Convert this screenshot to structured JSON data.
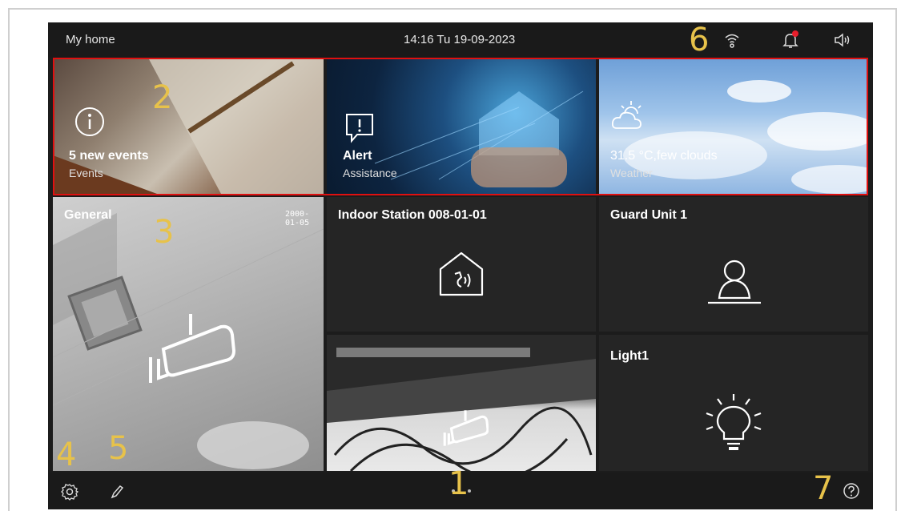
{
  "header": {
    "title": "My home",
    "clock": "14:16  Tu 19-09-2023"
  },
  "tiles": {
    "events": {
      "headline": "5 new events",
      "sub": "Events"
    },
    "alert": {
      "headline": "Alert",
      "sub": "Assistance"
    },
    "weather": {
      "headline": "31.5 °C,few clouds",
      "sub": "Weather"
    },
    "general": {
      "label": "General",
      "timestamp": "2000-01-05"
    },
    "indoor": {
      "label": "Indoor Station 008-01-01"
    },
    "guard": {
      "label": "Guard Unit 1"
    },
    "light": {
      "label": "Light1"
    }
  },
  "callouts": {
    "c1": "1",
    "c2": "2",
    "c3": "3",
    "c4": "4",
    "c5": "5",
    "c6": "6",
    "c7": "7"
  },
  "colors": {
    "highlight_box": "#e01010",
    "callout": "#e7c24a",
    "notification_dot": "#e81e2c"
  }
}
